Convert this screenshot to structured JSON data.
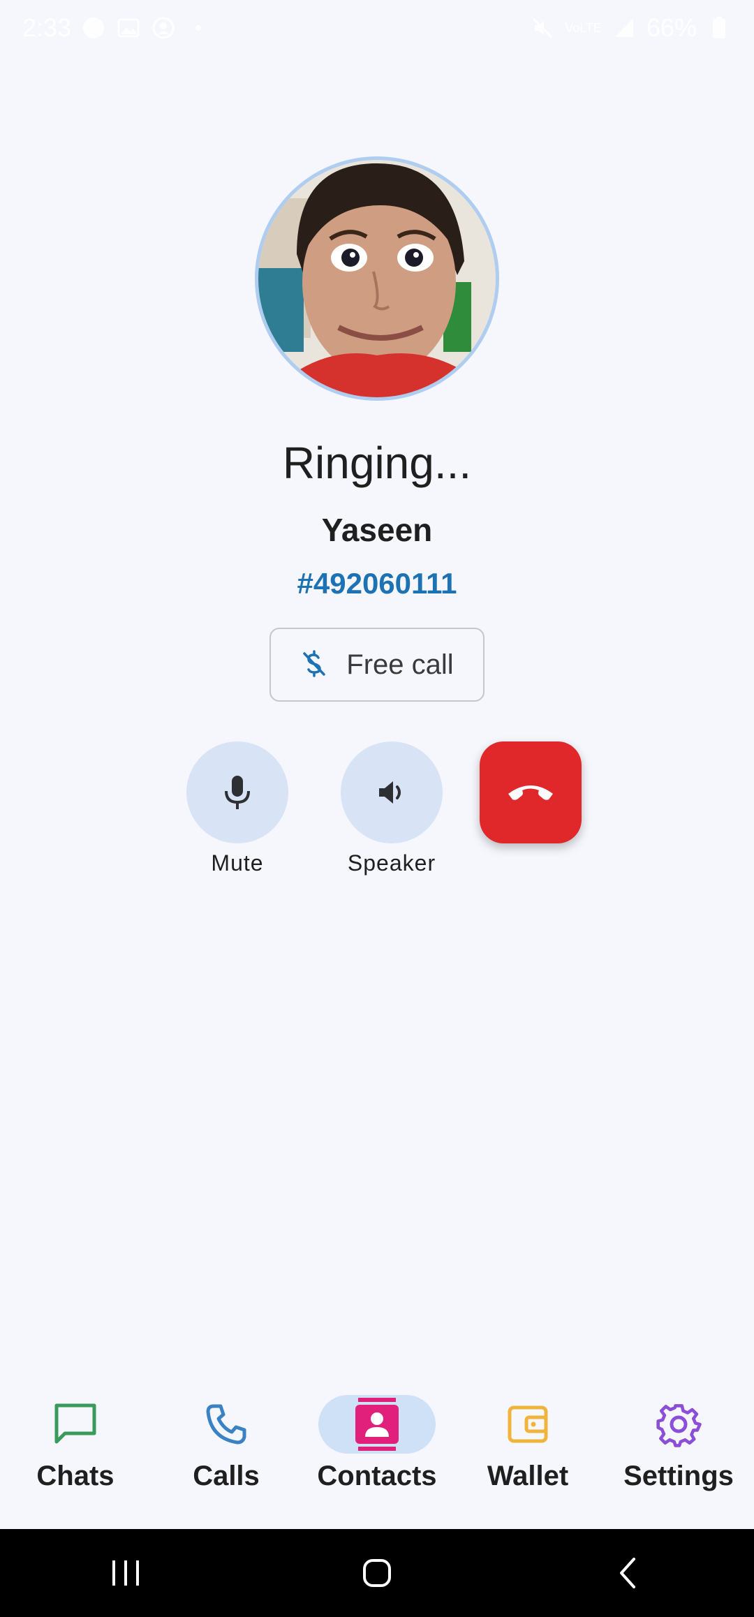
{
  "status_bar": {
    "time": "2:33",
    "signal_text": "VoLTE",
    "battery": "66%"
  },
  "call": {
    "status": "Ringing...",
    "contact_name": "Yaseen",
    "contact_id": "#492060111",
    "call_type_label": "Free call"
  },
  "controls": {
    "mute_label": "Mute",
    "speaker_label": "Speaker"
  },
  "bottom_nav": {
    "items": [
      {
        "label": "Chats",
        "icon": "chat-icon",
        "color": "#3a9a5b"
      },
      {
        "label": "Calls",
        "icon": "phone-icon",
        "color": "#3b82c4"
      },
      {
        "label": "Contacts",
        "icon": "contacts-icon",
        "color": "#e0207a",
        "active": true
      },
      {
        "label": "Wallet",
        "icon": "wallet-icon",
        "color": "#f0b43c"
      },
      {
        "label": "Settings",
        "icon": "gear-icon",
        "color": "#8a4fd6"
      }
    ]
  },
  "colors": {
    "accent_blue": "#1d72b4",
    "end_call_red": "#e0282a",
    "control_bg": "#d8e4f5",
    "page_bg": "#f6f7fc"
  }
}
